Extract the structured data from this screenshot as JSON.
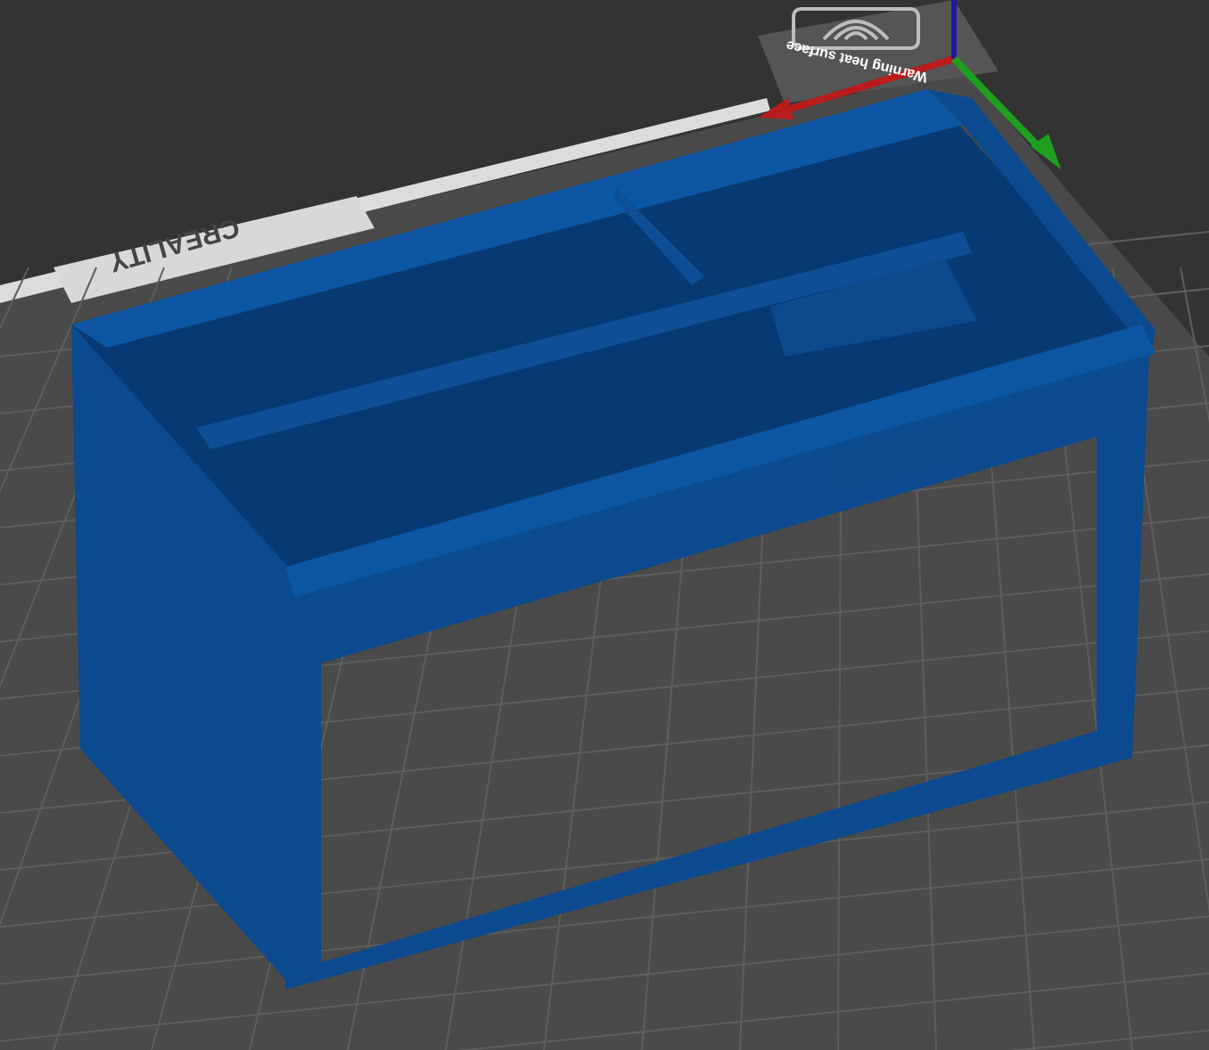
{
  "viewport": {
    "bed_logo": "CREALITY",
    "bed_warning": "Warning heat surface"
  }
}
